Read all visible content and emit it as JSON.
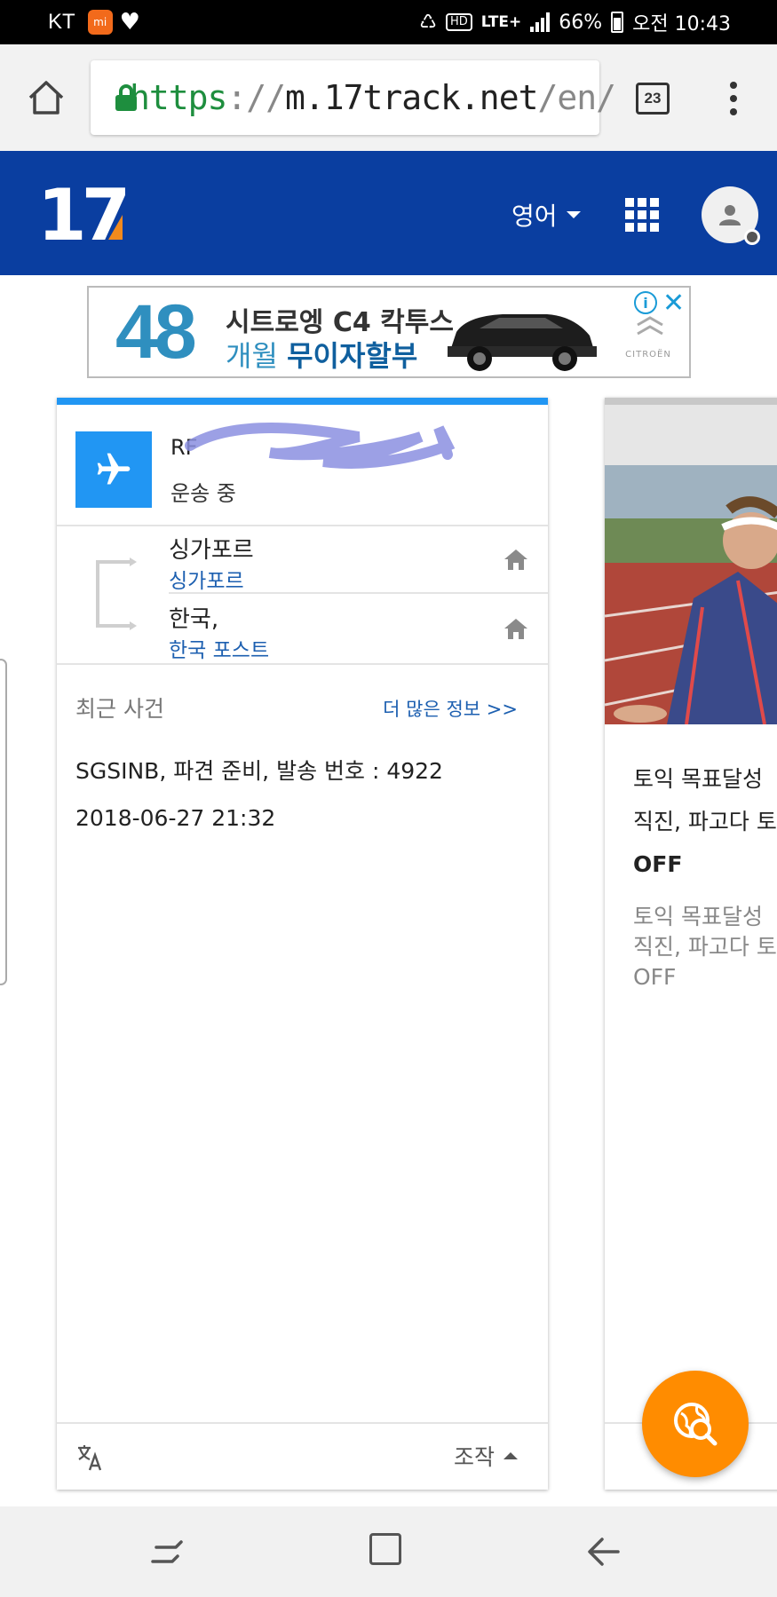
{
  "status_bar": {
    "carrier": "KT",
    "app_icon_label": "mi",
    "network": "LTE+",
    "hd": "HD",
    "battery": "66%",
    "time": "오전 10:43"
  },
  "browser": {
    "url_scheme": "https",
    "url_sep": "://",
    "url_host": "m.17track.net",
    "url_path": "/en/",
    "tab_count": "23"
  },
  "site_header": {
    "logo_text": "17",
    "language": "영어"
  },
  "ad": {
    "number": "48",
    "line1": "시트로엥 C4 칵투스",
    "line2_prefix": "개월 ",
    "line2_bold": "무이자할부",
    "brand": "CITROËN",
    "info": "i",
    "close": "✕"
  },
  "shipment": {
    "tracking_number": "RF",
    "status": "운송 중",
    "origin_country": "싱가포르",
    "origin_carrier": "싱가포르",
    "destination_country": "한국,",
    "destination_carrier": "한국 포스트",
    "events_title": "최근 사건",
    "more_info": "더 많은 정보 >>",
    "latest_event": "SGSINB, 파견 준비, 발송 번호 : 4922",
    "latest_event_time": "2018-06-27 21:32",
    "actions_label": "조작"
  },
  "promo_card": {
    "title_line1": "토익 목표달성",
    "title_line2": "직진, 파고다 토",
    "title_off": "OFF",
    "sub_line1": "토익 목표달성",
    "sub_line2": "직진, 파고다 토",
    "sub_off": "OFF"
  },
  "colors": {
    "header_blue": "#0a3ea0",
    "accent_blue": "#2196f3",
    "link_blue": "#1c5fb0",
    "fab_orange": "#ff8c00",
    "logo_orange": "#f28a1d"
  }
}
